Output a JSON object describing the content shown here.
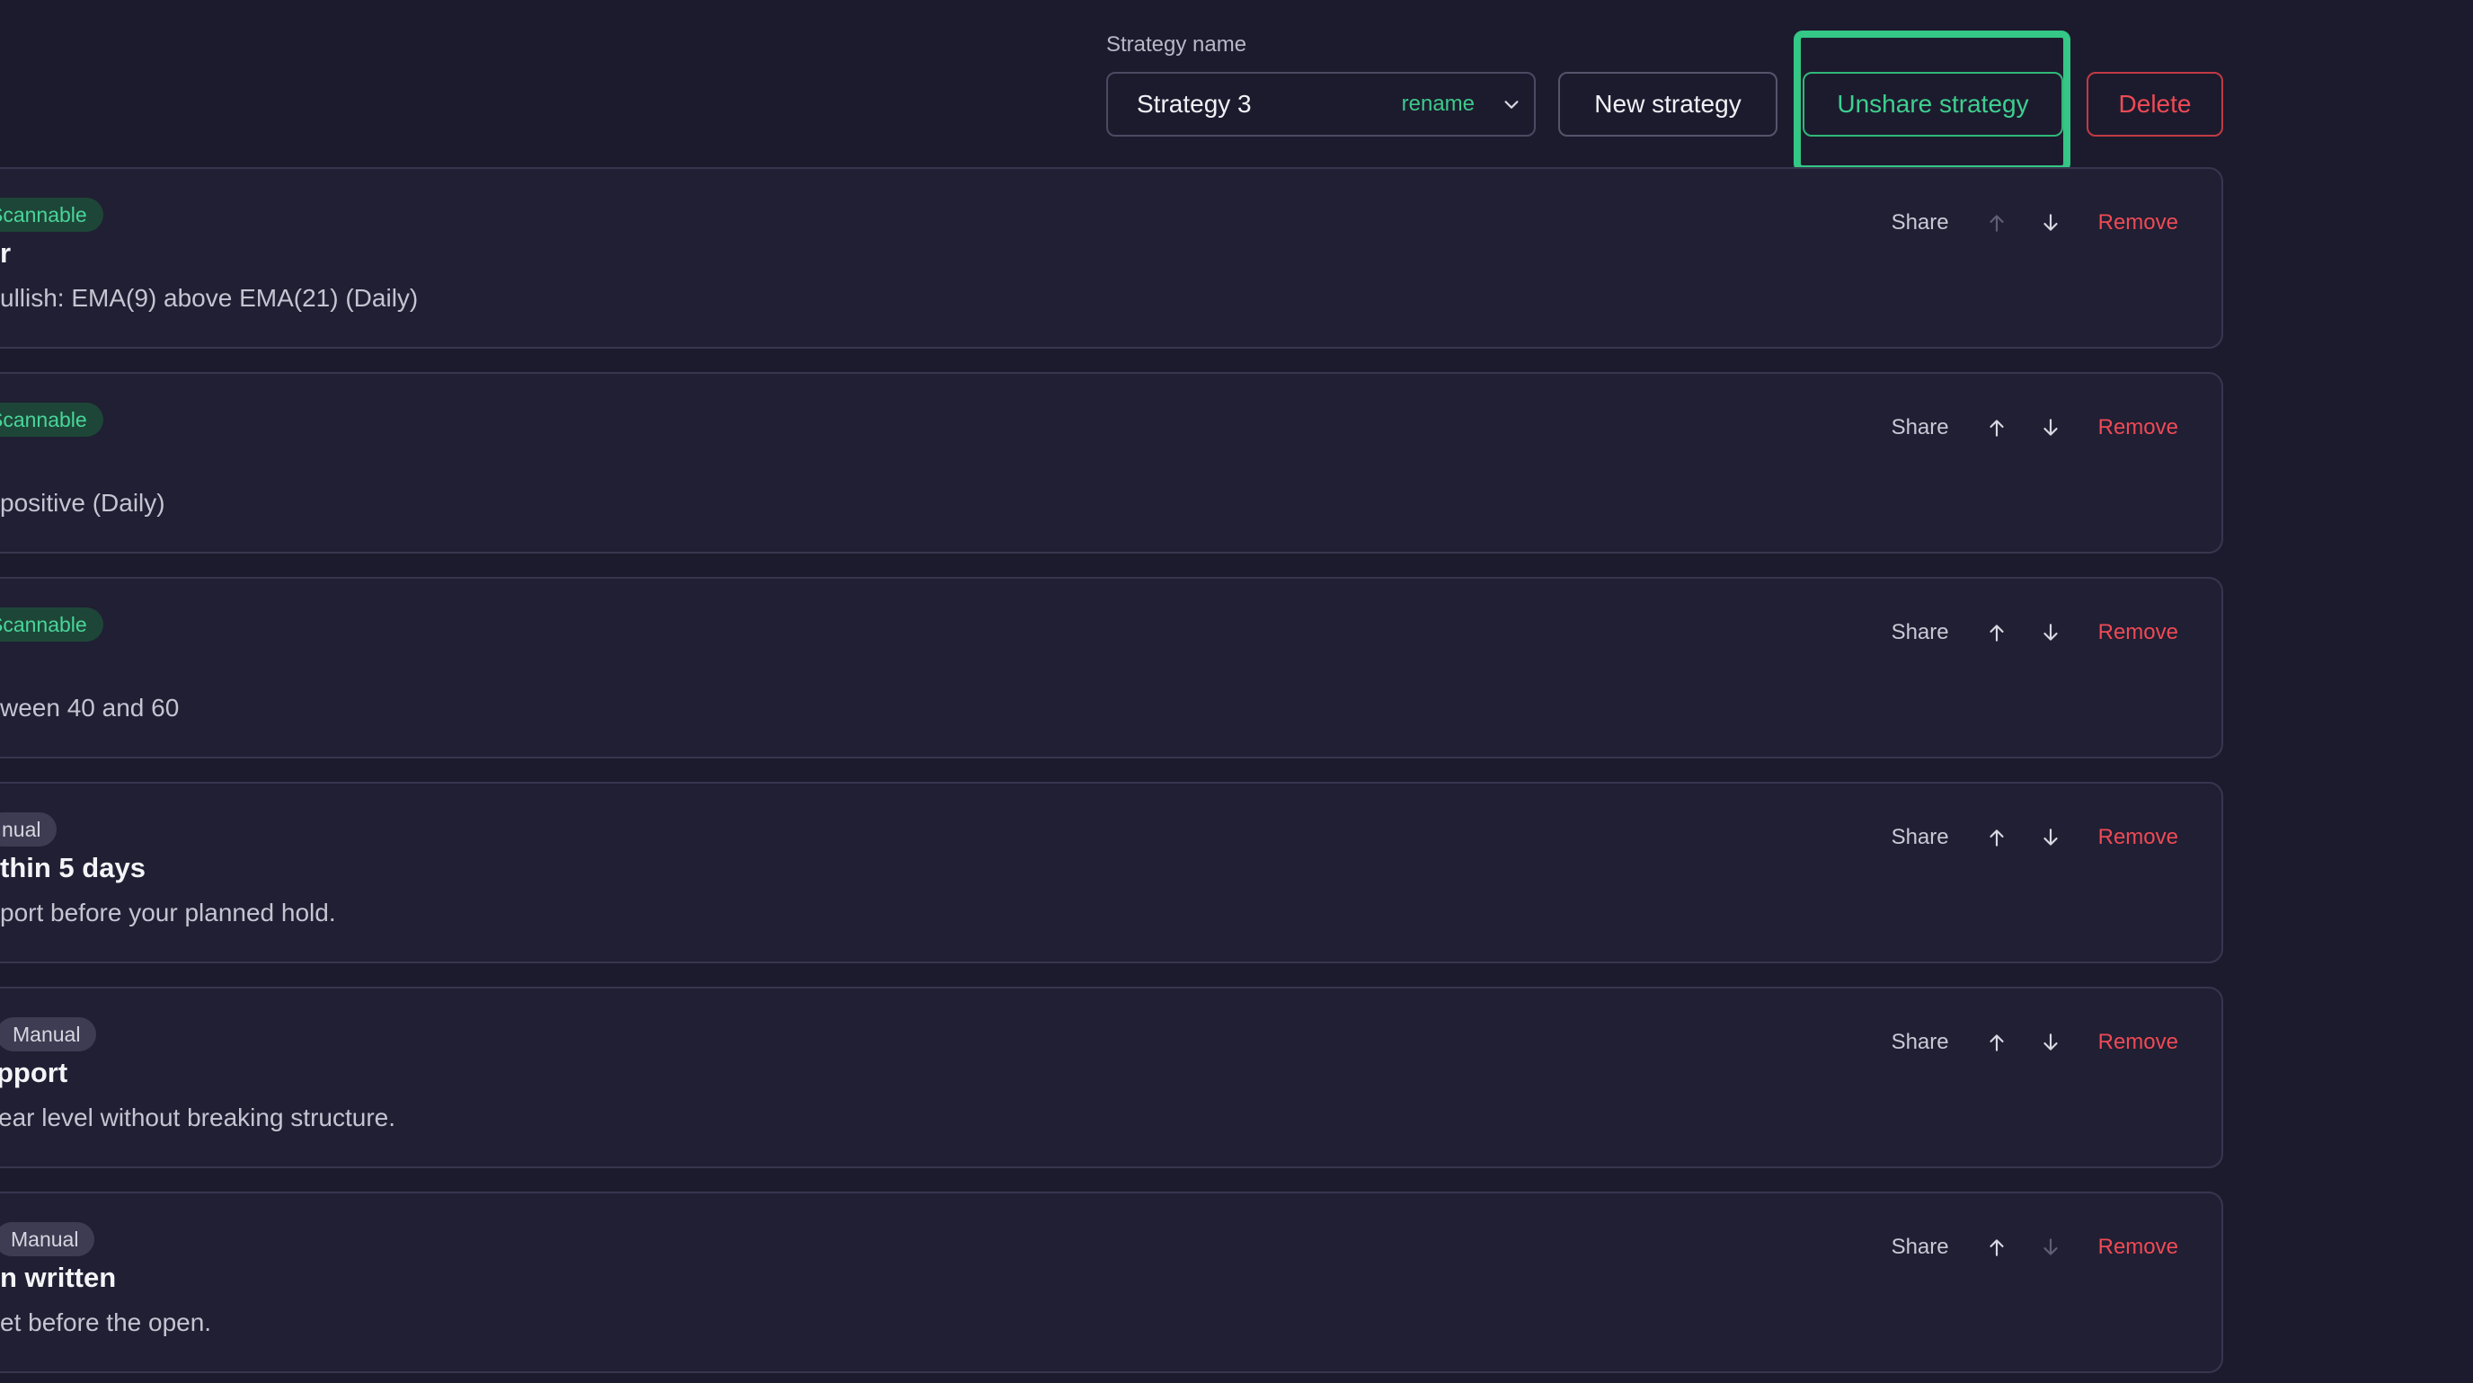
{
  "header": {
    "strategy_label": "Strategy name",
    "strategy_value": "Strategy 3",
    "rename_label": "rename",
    "new_strategy_label": "New strategy",
    "unshare_label": "Unshare strategy",
    "delete_label": "Delete"
  },
  "colors": {
    "background": "#1c1b2e",
    "accent_green": "#34c785",
    "danger_red": "#ef4a55"
  },
  "icons": {
    "dropdown": "chevron-down-icon",
    "move_up": "arrow-up-icon",
    "move_down": "arrow-down-icon"
  },
  "rules": [
    {
      "badge": "Scannable",
      "badge_type": "scannable",
      "title": "r",
      "description": "ullish: EMA(9) above EMA(21) (Daily)",
      "share": "Share",
      "remove": "Remove",
      "up_enabled": false,
      "down_enabled": true
    },
    {
      "badge": "Scannable",
      "badge_type": "scannable",
      "title": "",
      "description": "positive (Daily)",
      "share": "Share",
      "remove": "Remove",
      "up_enabled": true,
      "down_enabled": true
    },
    {
      "badge": "Scannable",
      "badge_type": "scannable",
      "title": "",
      "description": "ween 40 and 60",
      "share": "Share",
      "remove": "Remove",
      "up_enabled": true,
      "down_enabled": true
    },
    {
      "badge": "nual",
      "badge_type": "manual",
      "title": "thin 5 days",
      "description": "port before your planned hold.",
      "share": "Share",
      "remove": "Remove",
      "up_enabled": true,
      "down_enabled": true
    },
    {
      "badge": "Manual",
      "badge_type": "manual",
      "title": "pport",
      "description": "ear level without breaking structure.",
      "share": "Share",
      "remove": "Remove",
      "up_enabled": true,
      "down_enabled": true
    },
    {
      "badge": "Manual",
      "badge_type": "manual",
      "title": "n written",
      "description": "et before the open.",
      "share": "Share",
      "remove": "Remove",
      "up_enabled": true,
      "down_enabled": false
    }
  ]
}
